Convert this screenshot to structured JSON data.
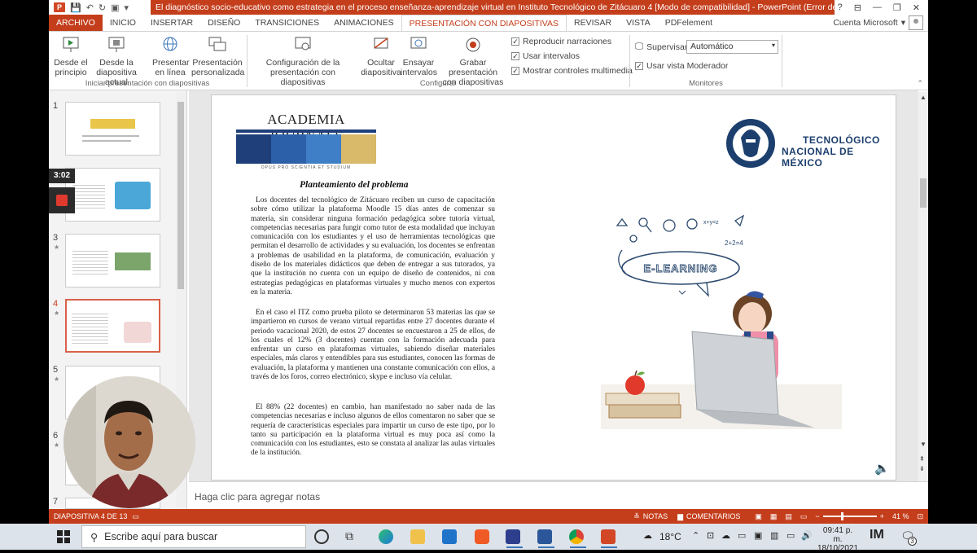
{
  "window": {
    "title": "El diagnóstico socio-educativo como estrategia en el proceso enseñanza-aprendizaje virtual en Instituto Tecnológico de Zitácuaro  4 [Modo de compatibilidad]  - PowerPoint (Error de activación...",
    "help": "?",
    "ribbon_display": "⊟",
    "minimize": "—",
    "restore": "❐",
    "close": "✕"
  },
  "tabs": [
    "ARCHIVO",
    "INICIO",
    "INSERTAR",
    "DISEÑO",
    "TRANSICIONES",
    "ANIMACIONES",
    "PRESENTACIÓN CON DIAPOSITIVAS",
    "REVISAR",
    "VISTA",
    "PDFelement"
  ],
  "active_tab_index": 6,
  "account": "Cuenta Microsoft",
  "ribbon": {
    "start_group": {
      "label": "Iniciar presentación con diapositivas",
      "from_start": [
        "Desde el",
        "principio"
      ],
      "from_current": [
        "Desde la",
        "diapositiva actual"
      ],
      "online": [
        "Presentar",
        "en línea"
      ],
      "custom": [
        "Presentación",
        "personalizada"
      ]
    },
    "setup_group": {
      "label": "Configurar",
      "setup": [
        "Configuración de la",
        "presentación con diapositivas"
      ],
      "hide": [
        "Ocultar",
        "diapositiva"
      ],
      "rehearse": [
        "Ensayar",
        "intervalos"
      ],
      "record": [
        "Grabar presentación",
        "con diapositivas"
      ],
      "play_narrations": "Reproducir narraciones",
      "use_timings": "Usar intervalos",
      "show_media_controls": "Mostrar controles multimedia"
    },
    "monitors_group": {
      "label": "Monitores",
      "monitor_label": "Supervisar:",
      "monitor_value": "Automático",
      "presenter_view": "Usar vista Moderador"
    }
  },
  "thumbnails": [
    {
      "num": "1",
      "star": ""
    },
    {
      "num": "2",
      "star": ""
    },
    {
      "num": "3",
      "star": "★"
    },
    {
      "num": "4",
      "star": "★"
    },
    {
      "num": "5",
      "star": "★"
    },
    {
      "num": "6",
      "star": "★"
    },
    {
      "num": "7",
      "star": ""
    }
  ],
  "slide": {
    "logo_left": "ACADEMIA JOURNALS",
    "logo_left_motto": "OPUS PRO SCIENTIA ET STUDIUM",
    "logo_right_line1": "TECNOLÓGICO",
    "logo_right_line2": "NACIONAL DE MÉXICO",
    "heading": "Planteamiento  del problema",
    "para1": "Los docentes del tecnológico de Zitácuaro reciben un curso de capacitación sobre cómo utilizar la plataforma Moodle 15 días antes de comenzar su materia, sin considerar ninguna formación pedagógica sobre tutoría virtual, competencias necesarias para fungir como tutor de esta modalidad que incluyan comunicación con los estudiantes y el uso de herramientas tecnológicas que permitan el desarrollo de actividades y su evaluación, los docentes se enfrentan a problemas de usabilidad en la plataforma, de comunicación, evaluación y diseño de los materiales didácticos que deben de entregar a sus tutorados, ya que la institución no cuenta con un equipo de diseño de contenidos, ni con estrategias pedagógicas en plataformas virtuales y mucho menos con expertos en la materia.",
    "para2": "En el caso el ITZ  como prueba piloto se determinaron 53 materias las que se impartieron en cursos de verano  virtual repartidas entre 27 docentes durante el periodo vacacional 2020, de estos 27 docentes se encuestaron a 25 de ellos, de los cuales el 12% (3 docentes) cuentan con la formación adecuada para enfrentar un curso en plataformas virtuales, sabiendo diseñar materiales especiales, más claros y entendibles para sus estudiantes, conocen las formas de evaluación, la plataforma y mantienen una constante comunicación con ellos, a través de los foros, correo electrónico, skype e incluso vía celular.",
    "para3": "El 88% (22 docentes) en cambio, han manifestado no saber nada de las competencias necesarias e incluso algunos de ellos comentaron no saber que se requería de características especiales para impartir un curso de este tipo, por lo tanto su participación en la plataforma virtual es muy poca así como la comunicación con los estudiantes, esto se constata al analizar las aulas virtuales de la institución.",
    "elearning": "E-LEARNING",
    "formula1": "x+y=z",
    "formula2": "2+2=4"
  },
  "notes_placeholder": "Haga clic para agregar notas",
  "status": {
    "slide_info": "DIAPOSITIVA 4 DE 13",
    "notes": "NOTAS",
    "comments": "COMENTARIOS",
    "zoom": "41 %"
  },
  "recorder": {
    "timer": "3:02"
  },
  "taskbar": {
    "search_placeholder": "Escribe aquí para buscar",
    "temperature": "18°C",
    "time": "09:41 p. m.",
    "date": "18/10/2021",
    "notif_count": "3"
  },
  "colors": {
    "accent": "#c43e1c",
    "taskbar": "#dde3ea"
  }
}
